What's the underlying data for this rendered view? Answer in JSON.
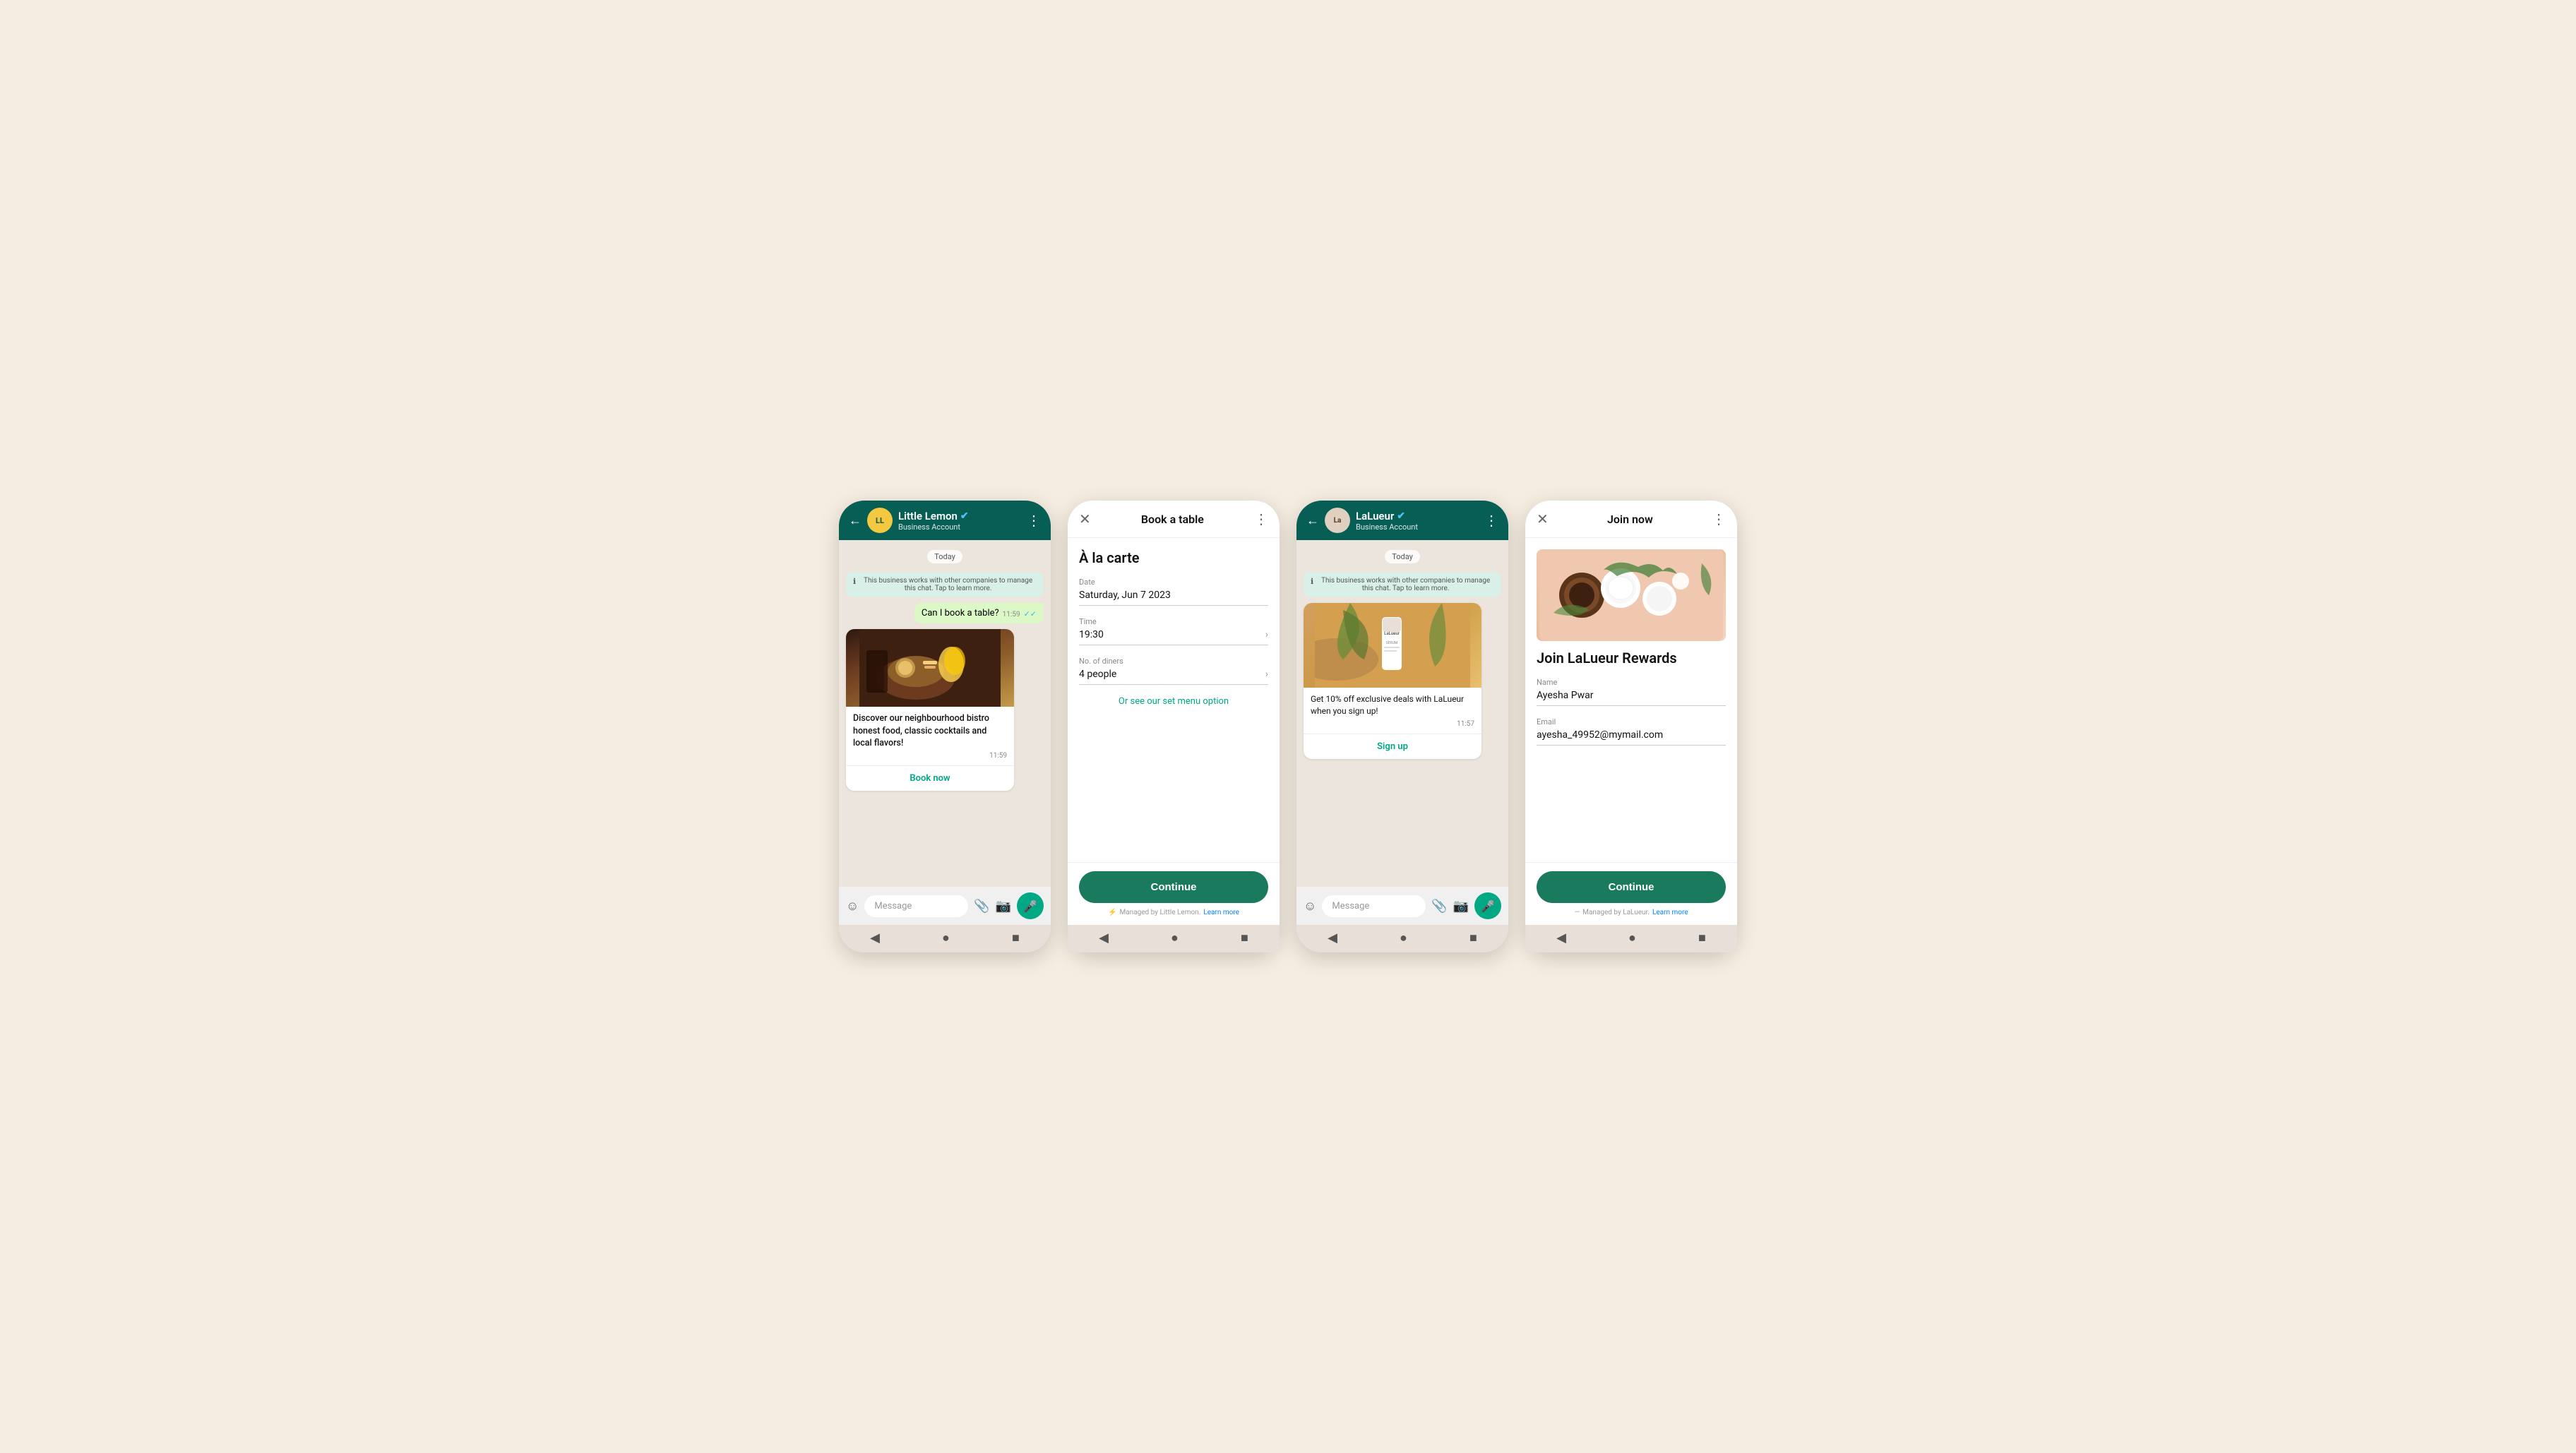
{
  "screens": [
    {
      "id": "phone1",
      "type": "chat",
      "header": {
        "name": "Little Lemon",
        "verified": true,
        "sub": "Business Account",
        "avatar_text": "LL",
        "avatar_color": "#f5c842"
      },
      "chat": {
        "date_badge": "Today",
        "info_notice": "This business works with other companies to manage this chat. Tap to learn more.",
        "outgoing_msg": "Can I book a table?",
        "outgoing_time": "11:59",
        "card": {
          "title": "Discover our neighbourhood bistro honest food, classic cocktails and local flavors!",
          "time": "11:59",
          "button": "Book now"
        }
      },
      "input": {
        "placeholder": "Message"
      }
    },
    {
      "id": "modal1",
      "type": "modal",
      "header": {
        "title": "Book a table"
      },
      "body": {
        "form_title": "À la carte",
        "fields": [
          {
            "label": "Date",
            "value": "Saturday, Jun 7 2023",
            "has_chevron": false
          },
          {
            "label": "Time",
            "value": "19:30",
            "has_chevron": true
          },
          {
            "label": "No. of diners",
            "value": "4 people",
            "has_chevron": true
          }
        ],
        "link": "Or see our set menu option"
      },
      "footer": {
        "button_label": "Continue",
        "managed_by": "Managed by Little Lemon.",
        "learn_more": "Learn more"
      }
    },
    {
      "id": "phone2",
      "type": "chat",
      "header": {
        "name": "LaLueur",
        "verified": true,
        "sub": "Business Account",
        "avatar_text": "La",
        "avatar_color": "#e0d0c0"
      },
      "chat": {
        "date_badge": "Today",
        "info_notice": "This business works with other companies to manage this chat. Tap to learn more.",
        "product": {
          "brand": "LaLueur",
          "desc": "Get 10% off exclusive deals with LaLueur when you sign up!",
          "time": "11:57",
          "button": "Sign up"
        }
      },
      "input": {
        "placeholder": "Message"
      }
    },
    {
      "id": "modal2",
      "type": "modal",
      "header": {
        "title": "Join now"
      },
      "body": {
        "rewards_title": "Join LaLueur Rewards",
        "fields": [
          {
            "label": "Name",
            "value": "Ayesha Pwar"
          },
          {
            "label": "Email",
            "value": "ayesha_49952@mymail.com"
          }
        ]
      },
      "footer": {
        "button_label": "Continue",
        "managed_by": "Managed by LaLueur.",
        "learn_more": "Learn more"
      }
    }
  ],
  "nav": {
    "back": "◀",
    "home": "●",
    "square": "■"
  }
}
